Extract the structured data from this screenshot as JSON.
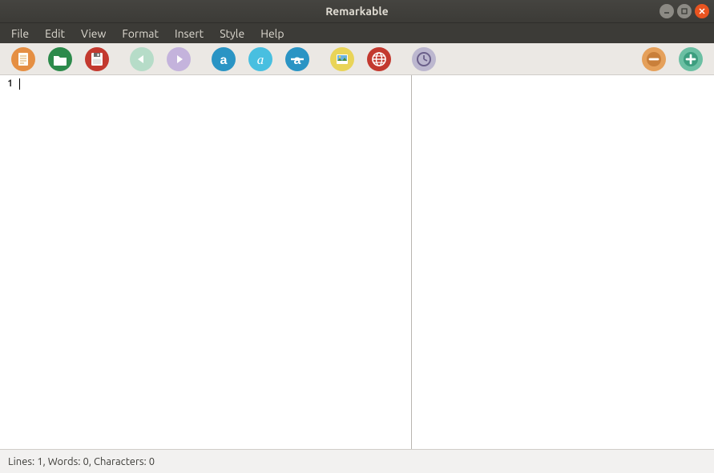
{
  "window": {
    "title": "Remarkable"
  },
  "menu": {
    "file": "File",
    "edit": "Edit",
    "view": "View",
    "format": "Format",
    "insert": "Insert",
    "style": "Style",
    "help": "Help"
  },
  "editor": {
    "line_number": "1",
    "content": ""
  },
  "status": {
    "text": "Lines: 1, Words: 0, Characters: 0",
    "lines": 1,
    "words": 0,
    "characters": 0
  },
  "toolbar_icons": {
    "new": "new-file",
    "open": "open-folder",
    "save": "save",
    "undo": "undo",
    "redo": "redo",
    "bold": "bold",
    "italic": "italic",
    "strike": "strikethrough",
    "image": "image",
    "link": "link",
    "timestamp": "timestamp",
    "zoom_out": "zoom-out",
    "zoom_in": "zoom-in"
  }
}
